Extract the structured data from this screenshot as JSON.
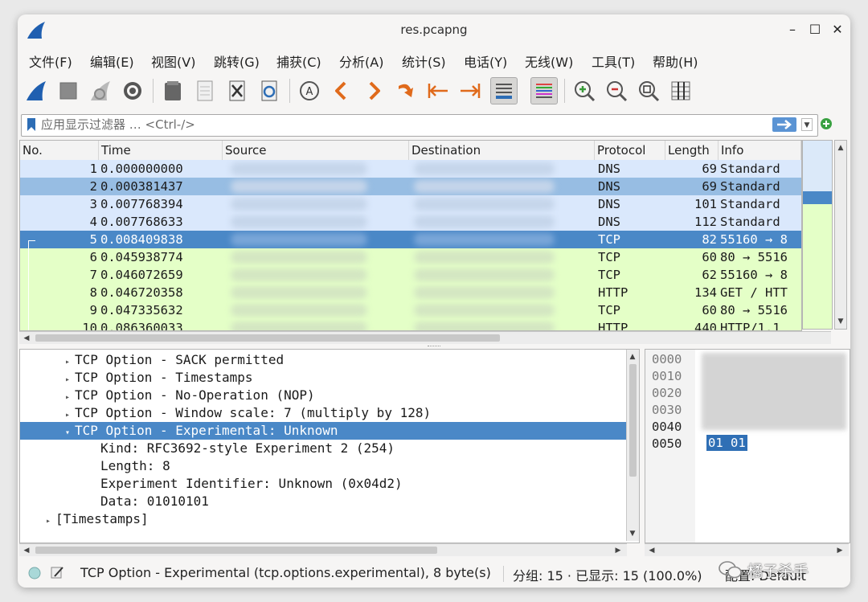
{
  "window": {
    "title": "res.pcapng"
  },
  "menu": [
    "文件(F)",
    "编辑(E)",
    "视图(V)",
    "跳转(G)",
    "捕获(C)",
    "分析(A)",
    "统计(S)",
    "电话(Y)",
    "无线(W)",
    "工具(T)",
    "帮助(H)"
  ],
  "filter": {
    "placeholder": "应用显示过滤器 … <Ctrl-/>"
  },
  "packet_list": {
    "columns": [
      "No.",
      "Time",
      "Source",
      "Destination",
      "Protocol",
      "Length",
      "Info"
    ],
    "rows": [
      {
        "no": "1",
        "time": "0.000000000",
        "protocol": "DNS",
        "length": "69",
        "info": "Standard"
      },
      {
        "no": "2",
        "time": "0.000381437",
        "protocol": "DNS",
        "length": "69",
        "info": "Standard"
      },
      {
        "no": "3",
        "time": "0.007768394",
        "protocol": "DNS",
        "length": "101",
        "info": "Standard"
      },
      {
        "no": "4",
        "time": "0.007768633",
        "protocol": "DNS",
        "length": "112",
        "info": "Standard"
      },
      {
        "no": "5",
        "time": "0.008409838",
        "protocol": "TCP",
        "length": "82",
        "info": "55160 → 8"
      },
      {
        "no": "6",
        "time": "0.045938774",
        "protocol": "TCP",
        "length": "60",
        "info": "80 → 5516"
      },
      {
        "no": "7",
        "time": "0.046072659",
        "protocol": "TCP",
        "length": "62",
        "info": "55160 → 8"
      },
      {
        "no": "8",
        "time": "0.046720358",
        "protocol": "HTTP",
        "length": "134",
        "info": "GET / HTT"
      },
      {
        "no": "9",
        "time": "0.047335632",
        "protocol": "TCP",
        "length": "60",
        "info": "80 → 5516"
      },
      {
        "no": "10",
        "time": "0.086360033",
        "protocol": "HTTP",
        "length": "440",
        "info": "HTTP/1.1"
      }
    ]
  },
  "details": {
    "lines": [
      "TCP Option - SACK permitted",
      "TCP Option - Timestamps",
      "TCP Option - No-Operation (NOP)",
      "TCP Option - Window scale: 7 (multiply by 128)",
      "TCP Option - Experimental: Unknown",
      "Kind: RFC3692-style Experiment 2 (254)",
      "Length: 8",
      "Experiment Identifier: Unknown (0x04d2)",
      "Data: 01010101",
      "[Timestamps]"
    ]
  },
  "bytes": {
    "offsets": [
      "0000",
      "0010",
      "0020",
      "0030",
      "0040",
      "0050"
    ],
    "highlight": "01 01"
  },
  "status": {
    "field": "TCP Option - Experimental (tcp.options.experimental), 8 byte(s)",
    "counts": "分组: 15 · 已显示: 15 (100.0%)",
    "profile": "配置: Default"
  },
  "watermark": "橘子杀手",
  "colors": {
    "accent_select": "#4a88c7",
    "dns_row": "#dae8fc",
    "dns_row_alt": "#d2e1f5",
    "tcp_row": "#e4ffc7",
    "highlight_bytes": "#2f6fb5"
  },
  "icons": {
    "toolbar": [
      "shark-fin-start-icon",
      "stop-square-icon",
      "restart-fin-icon",
      "capture-options-gear-icon",
      "open-file-icon",
      "save-file-icon",
      "close-file-icon",
      "reload-file-icon",
      "find-packet-icon",
      "previous-packet-icon",
      "next-packet-icon",
      "go-to-packet-icon",
      "first-packet-icon",
      "last-packet-icon",
      "auto-scroll-icon",
      "colorize-icon",
      "zoom-in-icon",
      "zoom-out-icon",
      "normal-size-icon",
      "resize-columns-icon"
    ]
  }
}
